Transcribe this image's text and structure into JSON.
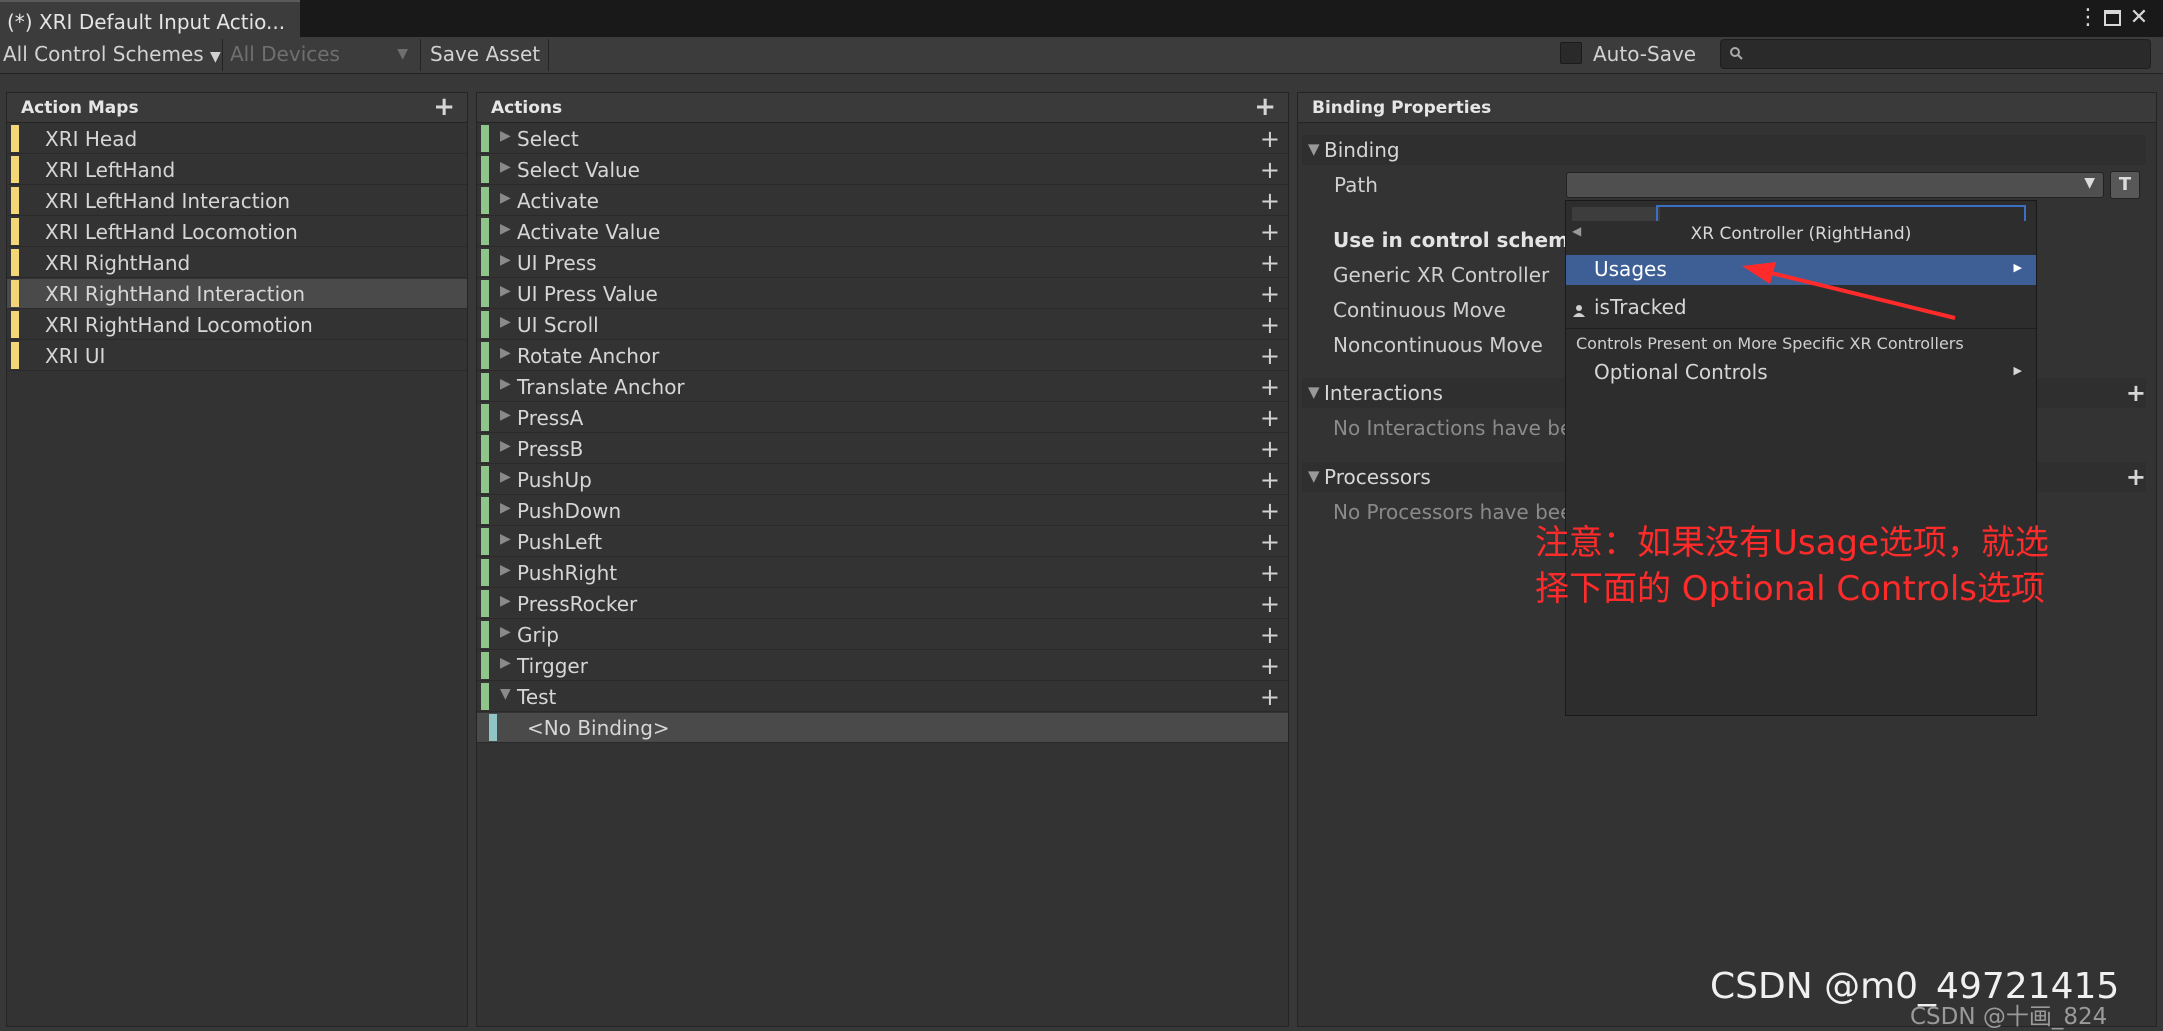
{
  "window": {
    "tab_title": "(*) XRI Default Input Actio...",
    "menu_icon": "⋮",
    "maximize_icon": "🗖",
    "close_icon": "✕"
  },
  "toolbar": {
    "control_scheme": "All Control Schemes",
    "devices": "All Devices",
    "save_asset": "Save Asset",
    "auto_save": "Auto-Save",
    "search_placeholder": ""
  },
  "action_maps": {
    "title": "Action Maps",
    "color": "#f2d677",
    "items": [
      "XRI Head",
      "XRI LeftHand",
      "XRI LeftHand Interaction",
      "XRI LeftHand Locomotion",
      "XRI RightHand",
      "XRI RightHand Interaction",
      "XRI RightHand Locomotion",
      "XRI UI"
    ],
    "selected": "XRI RightHand Interaction"
  },
  "actions": {
    "title": "Actions",
    "color": "#8fc58a",
    "items": [
      "Select",
      "Select Value",
      "Activate",
      "Activate Value",
      "UI Press",
      "UI Press Value",
      "UI Scroll",
      "Rotate Anchor",
      "Translate Anchor",
      "PressA",
      "PressB",
      "PushUp",
      "PushDown",
      "PushLeft",
      "PushRight",
      "PressRocker",
      "Grip",
      "Tirgger",
      "Test"
    ],
    "binding_label": "<No Binding>",
    "binding_color": "#8fc5c5"
  },
  "binding_properties": {
    "title": "Binding Properties",
    "binding_section": "Binding",
    "path_label": "Path",
    "t_button": "T",
    "use_in_scheme_label": "Use in control scheme",
    "schemes": [
      "Generic XR Controller",
      "Continuous Move",
      "Noncontinuous Move"
    ],
    "interactions_section": "Interactions",
    "interactions_empty": "No Interactions have bee",
    "processors_section": "Processors",
    "processors_empty": "No Processors have bee"
  },
  "popup": {
    "title": "XR Controller (RightHand)",
    "usages": "Usages",
    "is_tracked": "isTracked",
    "section_label": "Controls Present on More Specific XR Controllers",
    "optional_controls": "Optional Controls",
    "highlight_color": "#3e5f96"
  },
  "annotation": {
    "line1": "注意：如果没有Usage选项，就选",
    "line2": "择下面的 Optional Controls选项",
    "color": "#ff2b2b"
  },
  "watermark": {
    "main": "CSDN @m0_49721415",
    "secondary": "CSDN @十画_824"
  }
}
